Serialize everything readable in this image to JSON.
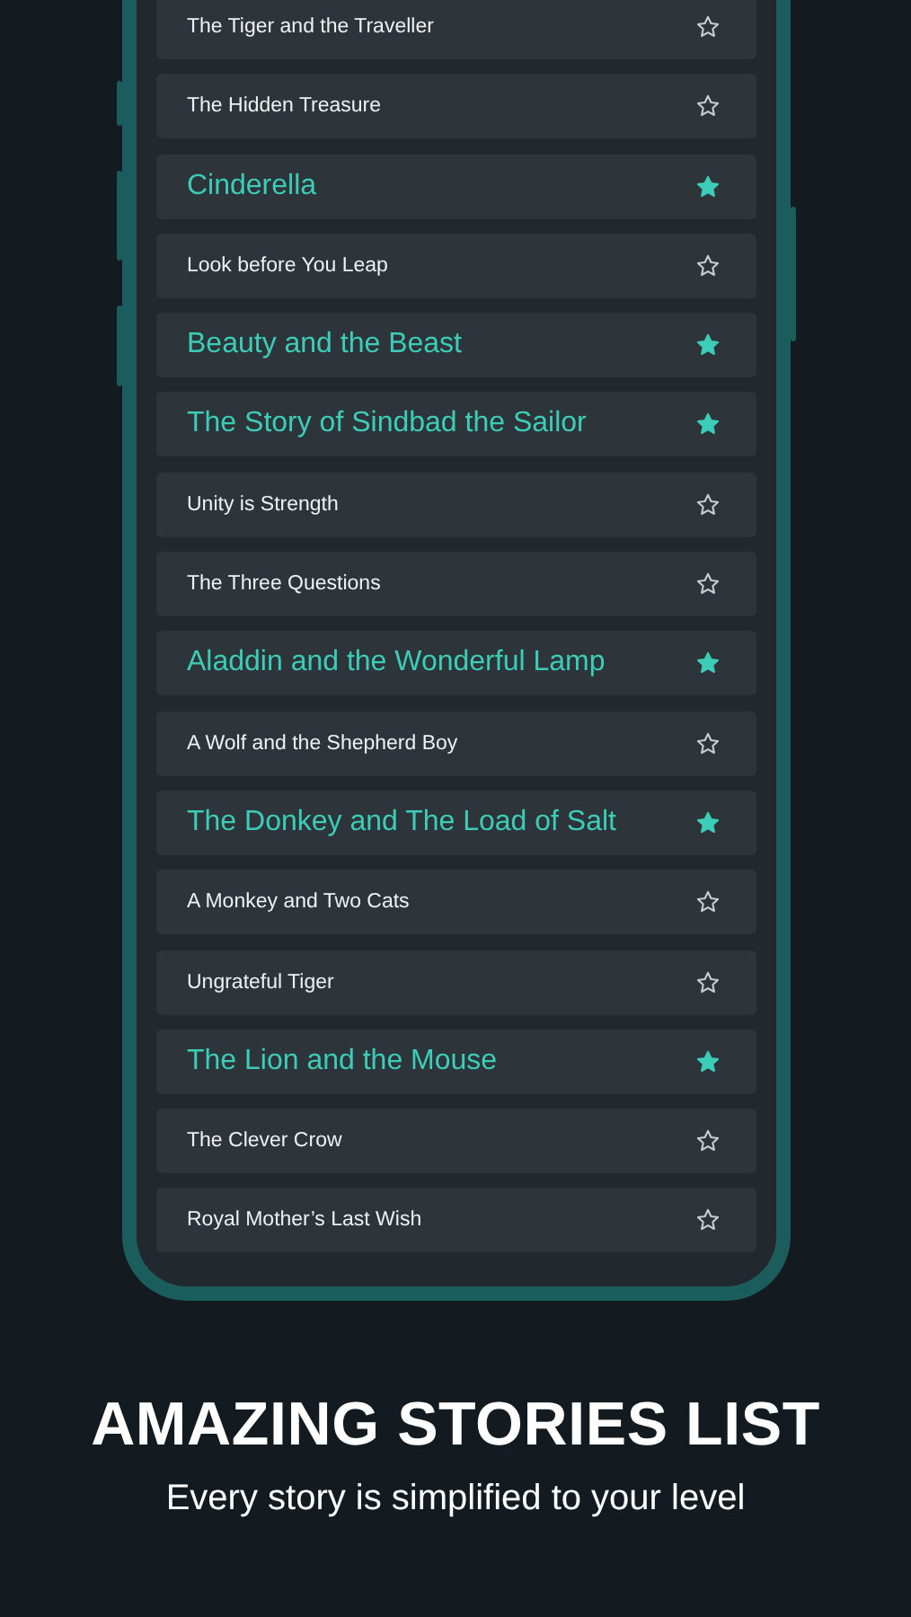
{
  "stories": [
    {
      "title": "The Tiger and the Traveller",
      "favorite": false
    },
    {
      "title": "The Hidden Treasure",
      "favorite": false
    },
    {
      "title": "Cinderella",
      "favorite": true
    },
    {
      "title": "Look before You Leap",
      "favorite": false
    },
    {
      "title": "Beauty and the Beast",
      "favorite": true
    },
    {
      "title": "The Story of Sindbad the Sailor",
      "favorite": true
    },
    {
      "title": "Unity is Strength",
      "favorite": false
    },
    {
      "title": "The Three Questions",
      "favorite": false
    },
    {
      "title": "Aladdin and the Wonderful Lamp",
      "favorite": true
    },
    {
      "title": "A Wolf and the Shepherd Boy",
      "favorite": false
    },
    {
      "title": "The Donkey and The Load of Salt",
      "favorite": true
    },
    {
      "title": "A Monkey and Two Cats",
      "favorite": false
    },
    {
      "title": "Ungrateful Tiger",
      "favorite": false
    },
    {
      "title": "The Lion and the Mouse",
      "favorite": true
    },
    {
      "title": "The Clever Crow",
      "favorite": false
    },
    {
      "title": "Royal Mother’s Last Wish",
      "favorite": false
    }
  ],
  "headline": "AMAZING STORIES LIST",
  "subtitle": "Every story is simplified to your level"
}
